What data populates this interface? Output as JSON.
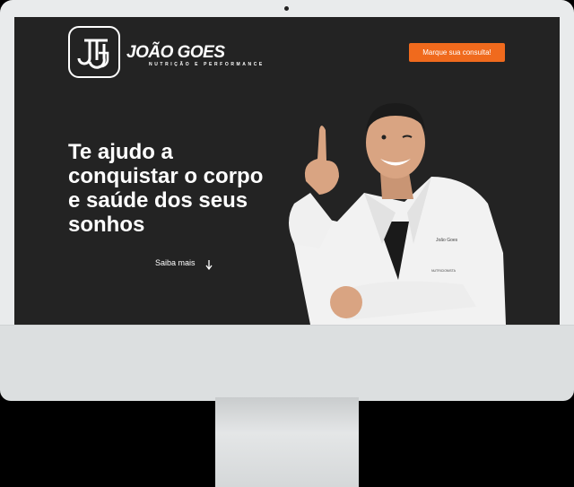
{
  "header": {
    "logo_name": "JOÃO GOES",
    "logo_tagline": "NUTRIÇÃO E PERFORMANCE",
    "cta_label": "Marque sua consulta!"
  },
  "hero": {
    "headline_lines": [
      "Te ajudo a",
      "conquistar o corpo",
      "e saúde dos seus",
      "sonhos"
    ],
    "secondary_link": "Saiba mais"
  },
  "coat": {
    "name_embroidery": "João Goes",
    "title_embroidery": "NUTRICIONISTA"
  },
  "colors": {
    "background": "#232323",
    "accent": "#f06a1d",
    "text": "#ffffff"
  },
  "icons": [
    "monogram-logo-icon",
    "arrow-down-icon"
  ]
}
